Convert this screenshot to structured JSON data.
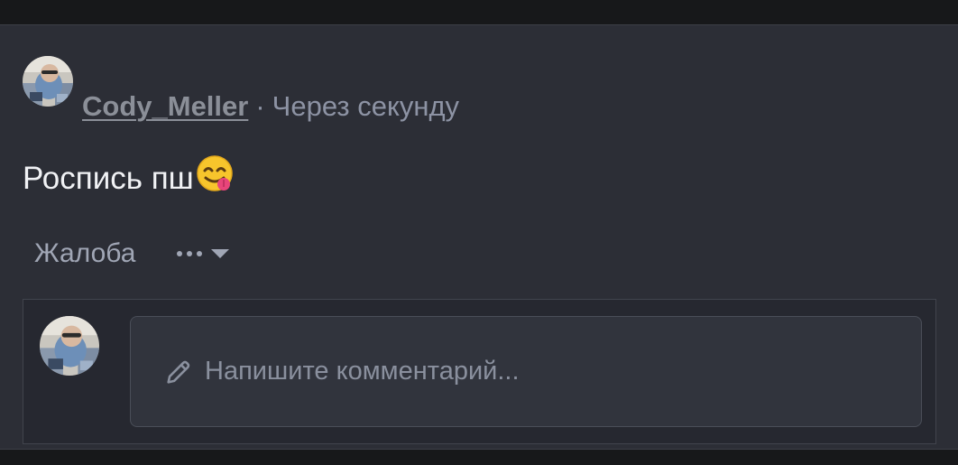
{
  "post": {
    "author": "Cody_Meller",
    "separator": "·",
    "time": "Через секунду",
    "text": "Роспись пш",
    "emoji_icon": "face-savoring-food-emoji"
  },
  "actions": {
    "report_label": "Жалоба",
    "more_icon": "more-dots-icon",
    "caret_icon": "caret-down-icon"
  },
  "comment": {
    "placeholder": "Напишите комментарий...",
    "pencil_icon": "pencil-icon"
  },
  "colors": {
    "card_background": "#2c2e36",
    "page_background": "#1a1b1e",
    "username": "#8b8f98",
    "muted_text": "#8d93a4",
    "post_text": "#f1f2f5"
  }
}
